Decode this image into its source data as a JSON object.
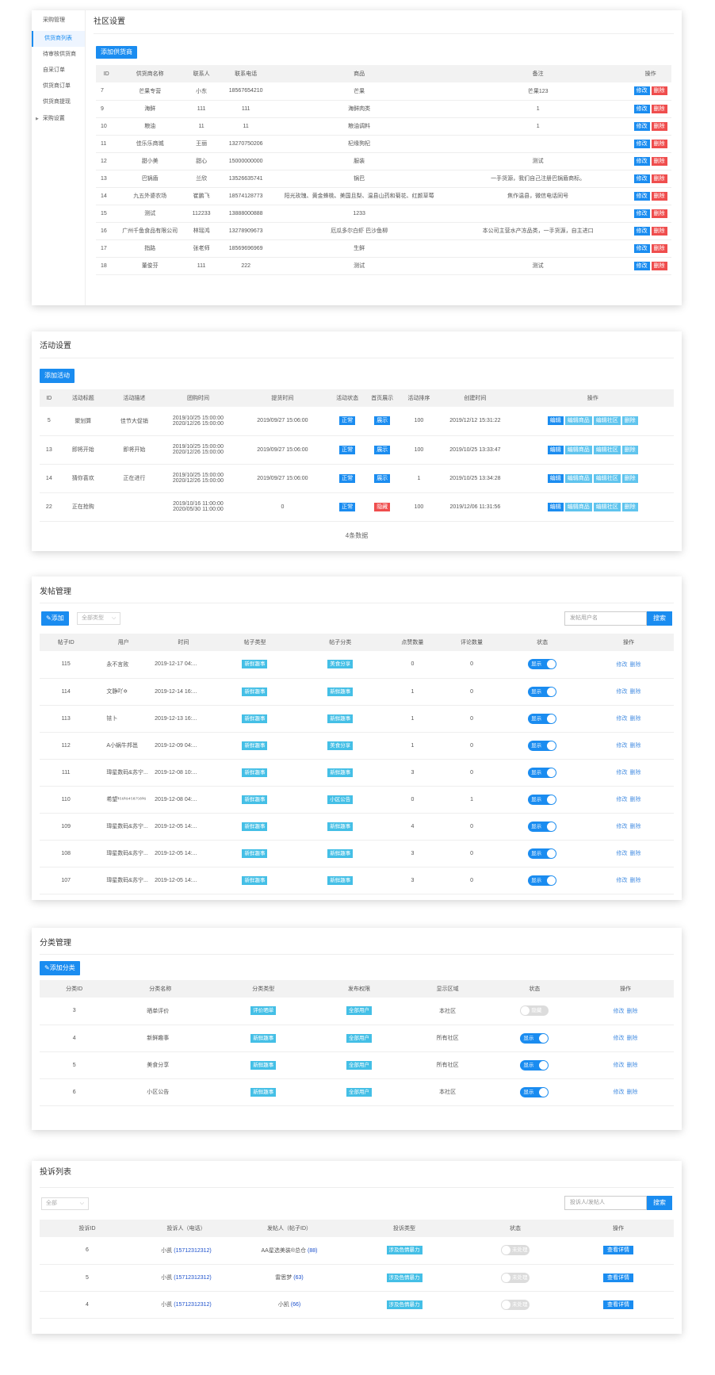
{
  "sidebar": {
    "header": "采购管理",
    "items": [
      "供货商列表",
      "待审核供货商",
      "自采订单",
      "供货商订单",
      "供货商提现"
    ],
    "group": "采购设置",
    "active_color": "#1a8cf0"
  },
  "supplier": {
    "title": "社区设置",
    "add_label": "添加供货商",
    "headers": [
      "ID",
      "供货商名称",
      "联系人",
      "联系电话",
      "商品",
      "备注",
      "操作"
    ],
    "edit_label": "修改",
    "delete_label": "删除",
    "rows": [
      [
        "7",
        "芒果专营",
        "小东",
        "18567654210",
        "芒果",
        "芒果123"
      ],
      [
        "9",
        "海鲜",
        "111",
        "111",
        "海鲜肉类",
        "1"
      ],
      [
        "10",
        "粮油",
        "11",
        "11",
        "粮油调料",
        "1"
      ],
      [
        "11",
        "佳乐乐商城",
        "王丽",
        "13270750206",
        "杞缘狗杞",
        ""
      ],
      [
        "12",
        "甜小美",
        "甜心",
        "15000000000",
        "服装",
        "测试"
      ],
      [
        "13",
        "巴锅盾",
        "兰欣",
        "13526635741",
        "锅巴",
        "一手货源，我们自己注册巴锅盾商标。"
      ],
      [
        "14",
        "九五外婆农场",
        "崔鹏飞",
        "18574128773",
        "阳光玫瑰、黄金蜂桃、美国且梨、温县山药和菊花、红颜草莓",
        "焦作温县，微信电话同号"
      ],
      [
        "15",
        "测试",
        "112233",
        "13888000888",
        "1233",
        ""
      ],
      [
        "16",
        "广州千鱼食品有限公司",
        "林瑶鸿",
        "13278909673",
        "厄瓜多尔白虾 巴沙鱼柳",
        "本公司主营水产冻品类，一手货源，自主进口"
      ],
      [
        "17",
        "指路",
        "张老师",
        "18569696969",
        "生鲜",
        ""
      ],
      [
        "18",
        "董俊芬",
        "111",
        "222",
        "测试",
        "测试"
      ]
    ]
  },
  "activity": {
    "title": "活动设置",
    "add_label": "添加活动",
    "headers": [
      "ID",
      "活动标题",
      "活动描述",
      "团购时间",
      "提货时间",
      "活动状态",
      "首页展示",
      "活动排序",
      "创建时间",
      "操作"
    ],
    "status_label": "正常",
    "actions": [
      "编辑",
      "编辑商品",
      "编辑社区",
      "删除"
    ],
    "rows": [
      {
        "id": "5",
        "title": "聚划算",
        "desc": "佳节大促销",
        "t1": "2019/10/25 15:00:00",
        "t2": "2020/12/26 15:00:00",
        "pickup": "2019/09/27 15:06:00",
        "show": "展示",
        "show_color": "blue",
        "sort": "100",
        "created": "2019/12/12 15:31:22"
      },
      {
        "id": "13",
        "title": "即将开始",
        "desc": "即将开始",
        "t1": "2019/10/25 15:00:00",
        "t2": "2020/12/26 15:00:00",
        "pickup": "2019/09/27 15:06:00",
        "show": "展示",
        "show_color": "blue",
        "sort": "100",
        "created": "2019/10/25 13:33:47"
      },
      {
        "id": "14",
        "title": "猜你喜欢",
        "desc": "正在进行",
        "t1": "2019/10/25 15:00:00",
        "t2": "2020/12/26 15:00:00",
        "pickup": "2019/09/27 15:06:00",
        "show": "展示",
        "show_color": "blue",
        "sort": "1",
        "created": "2019/10/25 13:34:28"
      },
      {
        "id": "22",
        "title": "正在抢购",
        "desc": "",
        "t1": "2019/10/16 11:00:00",
        "t2": "2020/05/30 11:00:00",
        "pickup": "0",
        "show": "隐藏",
        "show_color": "red",
        "sort": "100",
        "created": "2019/12/06 11:31:56"
      }
    ],
    "count_text": "4条数据"
  },
  "posts": {
    "title": "发帖管理",
    "add_label": "添加",
    "type_select": "全部类型",
    "search_placeholder": "发帖用户名",
    "search_label": "搜索",
    "headers": [
      "帖子ID",
      "用户",
      "时间",
      "帖子类型",
      "帖子分类",
      "点赞数量",
      "评论数量",
      "状态",
      "操作"
    ],
    "toggle_label": "显示",
    "edit_label": "修改",
    "delete_label": "删除",
    "rows": [
      [
        "115",
        "永不言败",
        "2019-12-17 04:...",
        "新鲜趣事",
        "美食分享",
        "0",
        "0"
      ],
      [
        "114",
        "文静吖✡",
        "2019-12-14 16:...",
        "新鲜趣事",
        "新鲜趣事",
        "1",
        "0"
      ],
      [
        "113",
        "铱卜",
        "2019-12-13 16:...",
        "新鲜趣事",
        "新鲜趣事",
        "1",
        "0"
      ],
      [
        "112",
        "A小蜗牛邦邕",
        "2019-12-09 04:...",
        "新鲜趣事",
        "美食分享",
        "1",
        "0"
      ],
      [
        "111",
        "瑋星数码&苏宁...",
        "2019-12-08 10:...",
        "新鲜趣事",
        "新鲜趣事",
        "3",
        "0"
      ],
      [
        "110",
        "希望¹⁵⁶¹⁹⁴⁵⁸⁷⁵⁸¹⁶",
        "2019-12-08 04:...",
        "新鲜趣事",
        "小区公告",
        "0",
        "1"
      ],
      [
        "109",
        "瑋星数码&苏宁...",
        "2019-12-05 14:...",
        "新鲜趣事",
        "新鲜趣事",
        "4",
        "0"
      ],
      [
        "108",
        "瑋星数码&苏宁...",
        "2019-12-05 14:...",
        "新鲜趣事",
        "新鲜趣事",
        "3",
        "0"
      ],
      [
        "107",
        "瑋星数码&苏宁...",
        "2019-12-05 14:...",
        "新鲜趣事",
        "新鲜趣事",
        "3",
        "0"
      ]
    ]
  },
  "category": {
    "title": "分类管理",
    "add_label": "添加分类",
    "headers": [
      "分类ID",
      "分类名称",
      "分类类型",
      "发布权限",
      "显示区域",
      "状态",
      "操作"
    ],
    "edit_label": "修改",
    "delete_label": "删除",
    "rows": [
      {
        "id": "3",
        "name": "晒单评价",
        "type": "评价晒单",
        "perm": "全部用户",
        "area": "本社区",
        "state": "隐藏",
        "on": false
      },
      {
        "id": "4",
        "name": "新鲜趣事",
        "type": "新鲜趣事",
        "perm": "全部用户",
        "area": "所有社区",
        "state": "显示",
        "on": true
      },
      {
        "id": "5",
        "name": "美食分享",
        "type": "新鲜趣事",
        "perm": "全部用户",
        "area": "所有社区",
        "state": "显示",
        "on": true
      },
      {
        "id": "6",
        "name": "小区公告",
        "type": "新鲜趣事",
        "perm": "全部用户",
        "area": "本社区",
        "state": "显示",
        "on": true
      }
    ]
  },
  "complaints": {
    "title": "投诉列表",
    "filter": "全部",
    "search_placeholder": "投诉人/发帖人",
    "search_label": "搜索",
    "headers": [
      "投诉ID",
      "投诉人（电话）",
      "发帖人（帖子ID）",
      "投诉类型",
      "状态",
      "操作"
    ],
    "type_label": "涉及色情暴力",
    "state_label": "未处理",
    "action_label": "查看详情",
    "rows": [
      {
        "id": "6",
        "name": "小凯",
        "phone": "(15712312312)",
        "poster": "AA星选美装®总仓",
        "pid": "(88)"
      },
      {
        "id": "5",
        "name": "小凯",
        "phone": "(15712312312)",
        "poster": "雷思梦",
        "pid": "(63)"
      },
      {
        "id": "4",
        "name": "小凯",
        "phone": "(15712312312)",
        "poster": "小凯",
        "pid": "(66)"
      }
    ]
  }
}
